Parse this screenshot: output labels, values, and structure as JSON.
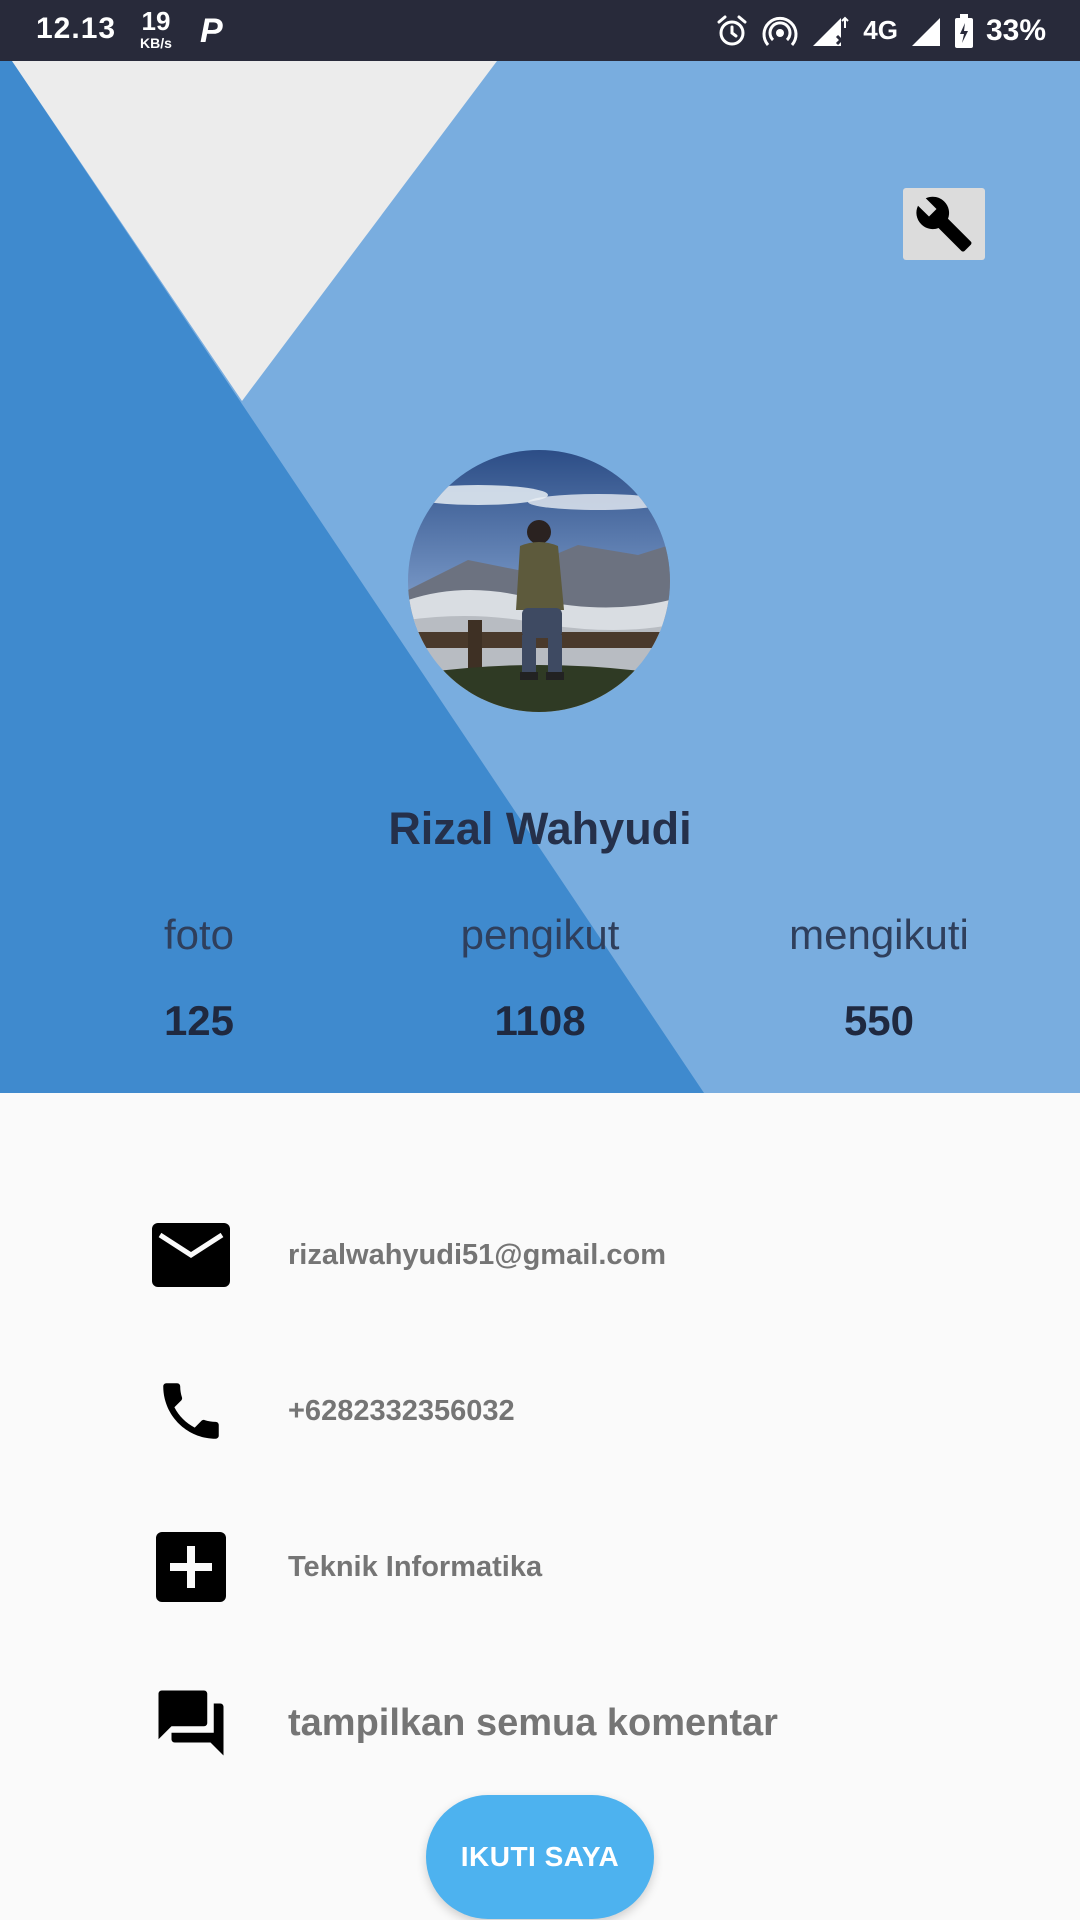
{
  "status_bar": {
    "time": "12.13",
    "speed_value": "19",
    "speed_unit": "KB/s",
    "app_badge": "P",
    "network": "4G",
    "battery": "33%"
  },
  "header": {
    "settings_icon": "wrench-icon",
    "colors": {
      "light_blue": "#79addf",
      "dark_blue": "#3f8ace",
      "grey": "#ececec"
    }
  },
  "profile": {
    "name": "Rizal Wahyudi"
  },
  "stats": [
    {
      "label": "foto",
      "value": "125"
    },
    {
      "label": "pengikut",
      "value": "1108"
    },
    {
      "label": "mengikuti",
      "value": "550"
    }
  ],
  "info": {
    "email": "rizalwahyudi51@gmail.com",
    "phone": "+6282332356032",
    "department": "Teknik Informatika",
    "comments_link": "tampilkan semua komentar"
  },
  "follow_button": {
    "label": "IKUTI SAYA",
    "color": "#4db2ef"
  }
}
